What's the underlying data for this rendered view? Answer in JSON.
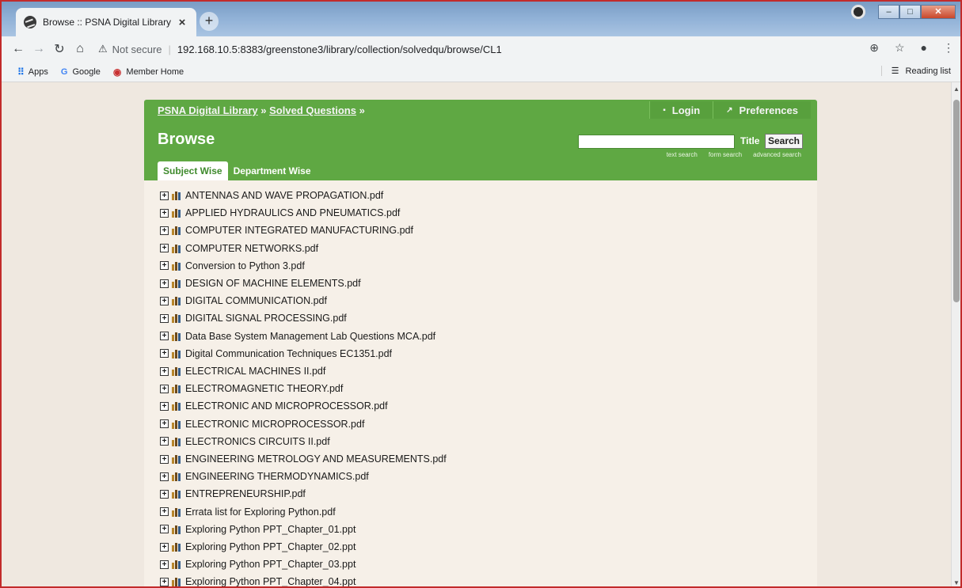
{
  "browser": {
    "tab_title": "Browse :: PSNA Digital Library",
    "tab_close": "×",
    "new_tab": "+",
    "not_secure": "Not secure",
    "url": "192.168.10.5:8383/greenstone3/library/collection/solvedqu/browse/CL1",
    "bookmarks": [
      "Apps",
      "Google",
      "Member Home"
    ],
    "reading_list": "Reading list"
  },
  "header": {
    "breadcrumb": [
      "PSNA Digital Library",
      "Solved Questions"
    ],
    "breadcrumb_sep": "»",
    "login": "Login",
    "preferences": "Preferences",
    "title": "Browse",
    "search_label": "Title",
    "search_button": "Search",
    "search_links": [
      "text search",
      "form search",
      "advanced search"
    ],
    "tabs": [
      "Subject Wise",
      "Department Wise"
    ]
  },
  "items": [
    "ANTENNAS AND WAVE PROPAGATION.pdf",
    "APPLIED HYDRAULICS AND PNEUMATICS.pdf",
    "COMPUTER INTEGRATED MANUFACTURING.pdf",
    "COMPUTER NETWORKS.pdf",
    "Conversion to Python 3.pdf",
    "DESIGN OF MACHINE ELEMENTS.pdf",
    "DIGITAL COMMUNICATION.pdf",
    "DIGITAL SIGNAL PROCESSING.pdf",
    "Data Base System Management Lab Questions MCA.pdf",
    "Digital Communication Techniques EC1351.pdf",
    "ELECTRICAL MACHINES II.pdf",
    "ELECTROMAGNETIC THEORY.pdf",
    "ELECTRONIC AND MICROPROCESSOR.pdf",
    "ELECTRONIC MICROPROCESSOR.pdf",
    "ELECTRONICS CIRCUITS II.pdf",
    "ENGINEERING METROLOGY AND MEASUREMENTS.pdf",
    "ENGINEERING THERMODYNAMICS.pdf",
    "ENTREPRENEURSHIP.pdf",
    "Errata list for Exploring Python.pdf",
    "Exploring Python PPT_Chapter_01.ppt",
    "Exploring Python PPT_Chapter_02.ppt",
    "Exploring Python PPT_Chapter_03.ppt",
    "Exploring Python PPT_Chapter_04.ppt"
  ]
}
